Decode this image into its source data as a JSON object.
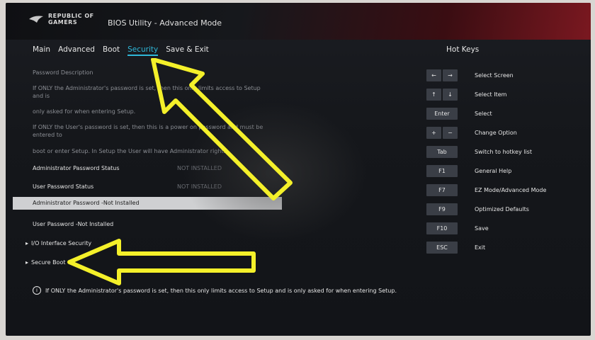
{
  "header": {
    "logo_text": "REPUBLIC OF GAMERS",
    "app_title": "BIOS Utility - Advanced Mode"
  },
  "tabs": [
    {
      "label": "Main"
    },
    {
      "label": "Advanced"
    },
    {
      "label": "Boot"
    },
    {
      "label": "Security"
    },
    {
      "label": "Save & Exit"
    }
  ],
  "active_tab": "Security",
  "hotkeys": {
    "title": "Hot Keys",
    "items": [
      {
        "keys": [
          "←",
          "→"
        ],
        "label": "Select Screen"
      },
      {
        "keys": [
          "↑",
          "↓"
        ],
        "label": "Select Item"
      },
      {
        "keys": [
          "Enter"
        ],
        "label": "Select"
      },
      {
        "keys": [
          "+",
          "−"
        ],
        "label": "Change Option"
      },
      {
        "keys": [
          "Tab"
        ],
        "label": "Switch to hotkey list"
      },
      {
        "keys": [
          "F1"
        ],
        "label": "General Help"
      },
      {
        "keys": [
          "F7"
        ],
        "label": "EZ Mode/Advanced Mode"
      },
      {
        "keys": [
          "F9"
        ],
        "label": "Optimized Defaults"
      },
      {
        "keys": [
          "F10"
        ],
        "label": "Save"
      },
      {
        "keys": [
          "ESC"
        ],
        "label": "Exit"
      }
    ]
  },
  "security": {
    "description_title": "Password Description",
    "desc_line1": "If ONLY the Administrator's password is set, then this only limits access to Setup",
    "desc_line1b": "and is",
    "desc_line2": "only asked for when entering Setup.",
    "desc_line3": "If ONLY the User's password is set, then this is a power on password and must be",
    "desc_line3b": "entered to",
    "desc_line4": "boot or enter Setup. In Setup the User will have Administrator rights.",
    "admin_status_label": "Administrator Password Status",
    "admin_status_value": "NOT INSTALLED",
    "user_status_label": "User Password Status",
    "user_status_value": "NOT INSTALLED",
    "admin_password_item": "Administrator Password -Not Installed",
    "user_password_item": "User Password -Not Installed",
    "io_security": "I/O Interface Security",
    "secure_boot": "Secure Boot"
  },
  "info_text": "If ONLY the Administrator's password is set, then this only limits access to Setup and is only asked for when entering Setup.",
  "colors": {
    "accent": "#2fb7d8",
    "highlight_bg": "#cfd0d2",
    "annotation_arrow": "#f4f02a"
  }
}
